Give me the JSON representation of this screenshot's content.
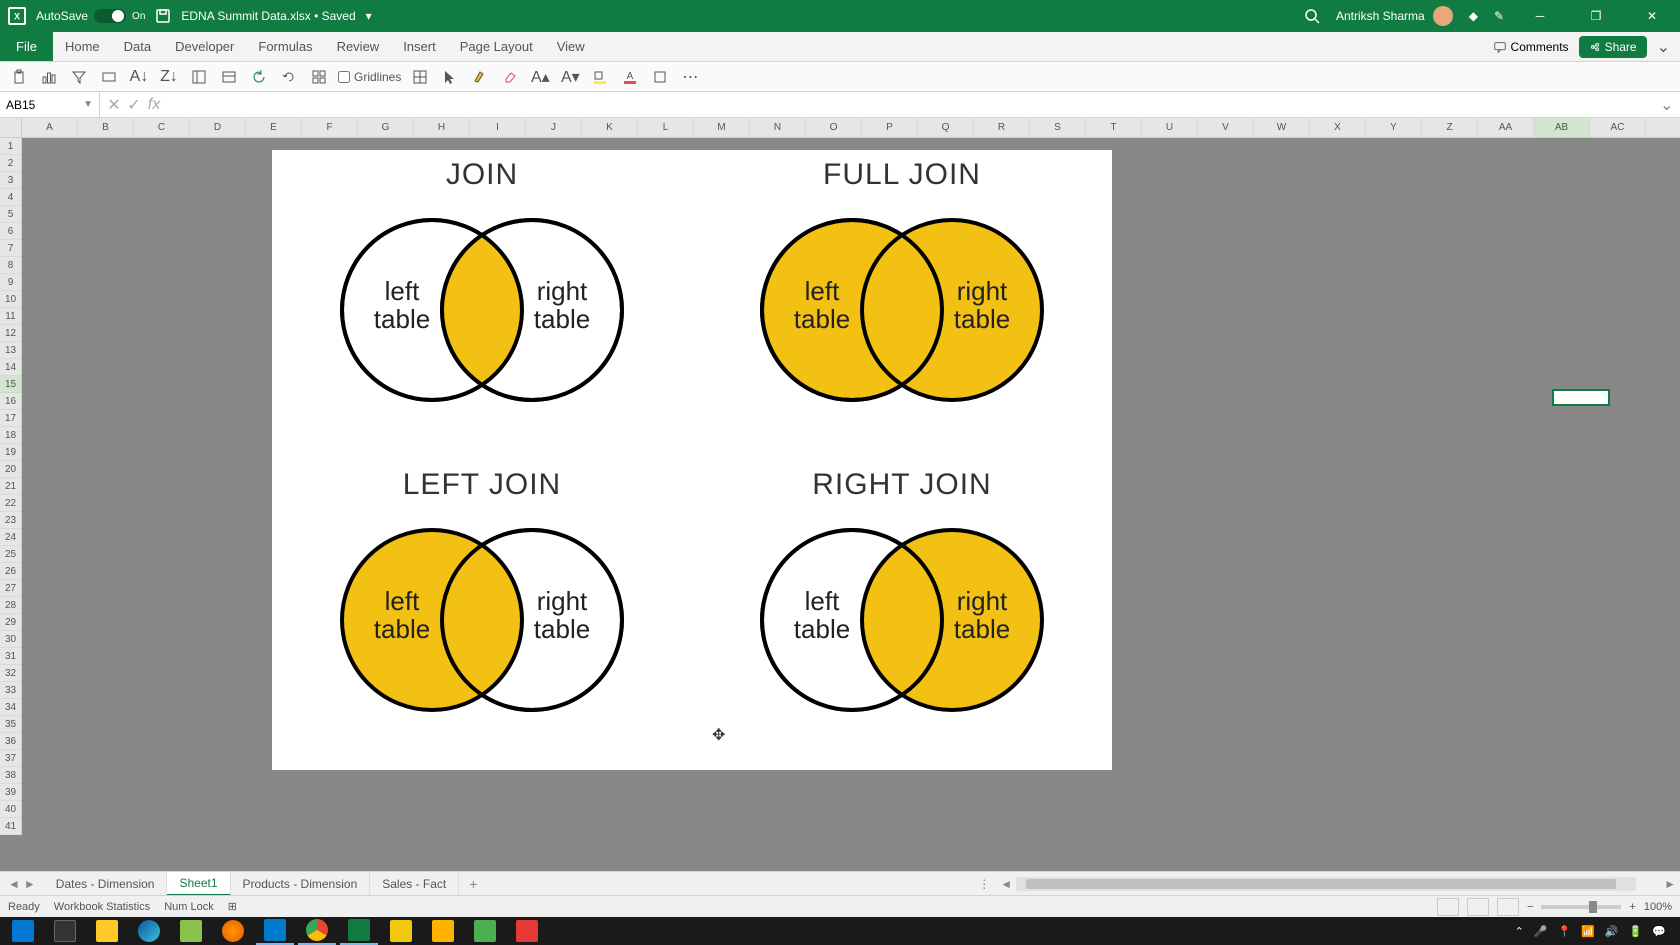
{
  "title_bar": {
    "autosave_label": "AutoSave",
    "autosave_on": "On",
    "document_name": "EDNA Summit Data.xlsx • Saved",
    "user_name": "Antriksh Sharma"
  },
  "ribbon": {
    "tabs": [
      "File",
      "Home",
      "Data",
      "Developer",
      "Formulas",
      "Review",
      "Insert",
      "Page Layout",
      "View"
    ],
    "comments": "Comments",
    "share": "Share",
    "gridlines": "Gridlines"
  },
  "formula_bar": {
    "cell_ref": "AB15",
    "fx": "fx"
  },
  "columns": [
    "A",
    "B",
    "C",
    "D",
    "E",
    "F",
    "G",
    "H",
    "I",
    "J",
    "K",
    "L",
    "M",
    "N",
    "O",
    "P",
    "Q",
    "R",
    "S",
    "T",
    "U",
    "V",
    "W",
    "X",
    "Y",
    "Z",
    "AA",
    "AB",
    "AC"
  ],
  "selected_col": "AB",
  "selected_row": "15",
  "row_count": 41,
  "sheet_tabs": [
    "Dates - Dimension",
    "Sheet1",
    "Products - Dimension",
    "Sales - Fact"
  ],
  "active_sheet": "Sheet1",
  "status": {
    "ready": "Ready",
    "workbook_stats": "Workbook Statistics",
    "numlock": "Num Lock",
    "zoom": "100%"
  },
  "diagram": {
    "join": {
      "title": "JOIN",
      "left": "left",
      "left2": "table",
      "right": "right",
      "right2": "table"
    },
    "full": {
      "title": "FULL JOIN",
      "left": "left",
      "left2": "table",
      "right": "right",
      "right2": "table"
    },
    "leftj": {
      "title": "LEFT JOIN",
      "left": "left",
      "left2": "table",
      "right": "right",
      "right2": "table"
    },
    "rightj": {
      "title": "RIGHT JOIN",
      "left": "left",
      "left2": "table",
      "right": "right",
      "right2": "table"
    }
  },
  "colors": {
    "accent": "#107c41",
    "venn_fill": "#f3c014"
  }
}
